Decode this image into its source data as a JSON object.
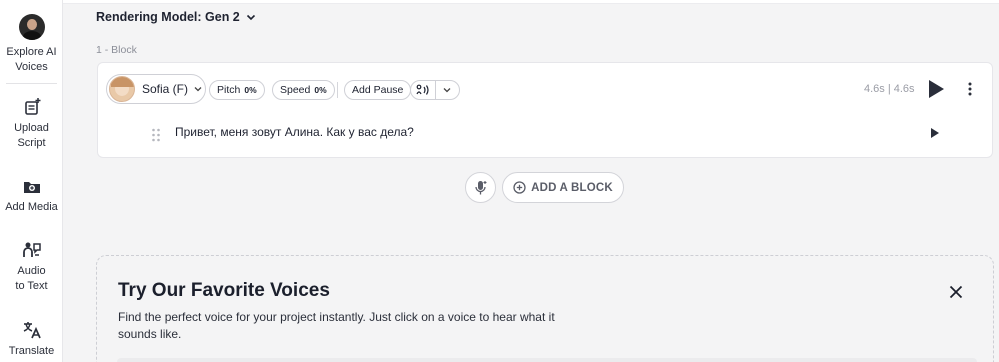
{
  "sidebar": {
    "items": [
      {
        "label": "Explore AI Voices",
        "icon": "voice-avatar-icon"
      },
      {
        "label": "Upload Script",
        "icon": "upload-script-icon"
      },
      {
        "label": "Add Media",
        "icon": "add-media-icon"
      },
      {
        "label": "Audio to Text",
        "icon": "audio-to-text-icon"
      },
      {
        "label": "Translate",
        "icon": "translate-icon"
      }
    ]
  },
  "header": {
    "rendering_model": "Rendering Model: Gen 2"
  },
  "block": {
    "label": "1 -  Block",
    "voice_name": "Sofia (F)",
    "pitch_label": "Pitch",
    "pitch_value": "0%",
    "speed_label": "Speed",
    "speed_value": "0%",
    "add_pause_label": "Add Pause",
    "duration": "4.6s | 4.6s",
    "text": "Привет, меня зовут Алина. Как у вас дела?"
  },
  "actions": {
    "add_block_label": "ADD A BLOCK"
  },
  "promo": {
    "title": "Try Our Favorite Voices",
    "description": "Find the perfect voice for your project instantly. Just click on a voice to hear what it sounds like."
  },
  "colors": {
    "background": "#f4f4f5",
    "text_primary": "#1e2230",
    "muted": "#9a9ca5",
    "border": "#cfd0d6"
  }
}
